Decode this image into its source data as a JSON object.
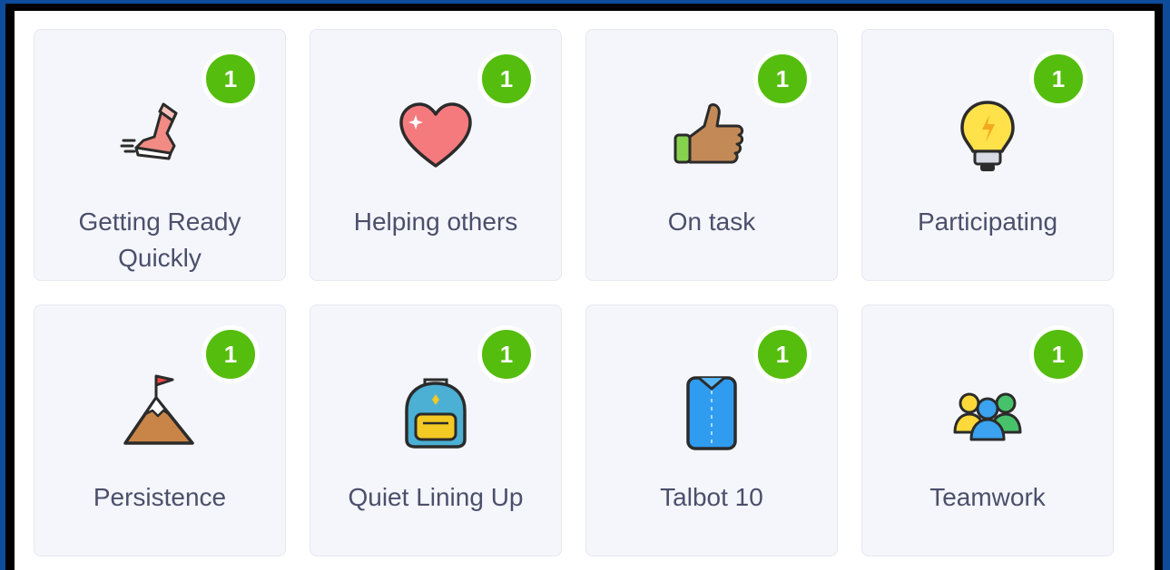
{
  "colors": {
    "page_background": "#0c4c9a",
    "card_background": "#f5f6fb",
    "badge_green": "#55bd0d",
    "label_text": "#4b4f6b"
  },
  "skills": [
    {
      "label_line1": "Getting Ready",
      "label_line2": "Quickly",
      "count": "1",
      "icon": "running-shoe-icon"
    },
    {
      "label_line1": "Helping others",
      "label_line2": "",
      "count": "1",
      "icon": "heart-icon"
    },
    {
      "label_line1": "On task",
      "label_line2": "",
      "count": "1",
      "icon": "thumbs-up-icon"
    },
    {
      "label_line1": "Participating",
      "label_line2": "",
      "count": "1",
      "icon": "lightbulb-icon"
    },
    {
      "label_line1": "Persistence",
      "label_line2": "",
      "count": "1",
      "icon": "mountain-flag-icon"
    },
    {
      "label_line1": "Quiet Lining Up",
      "label_line2": "",
      "count": "1",
      "icon": "backpack-icon"
    },
    {
      "label_line1": "Talbot 10",
      "label_line2": "",
      "count": "1",
      "icon": "shirt-icon"
    },
    {
      "label_line1": "Teamwork",
      "label_line2": "",
      "count": "1",
      "icon": "team-icon"
    }
  ]
}
